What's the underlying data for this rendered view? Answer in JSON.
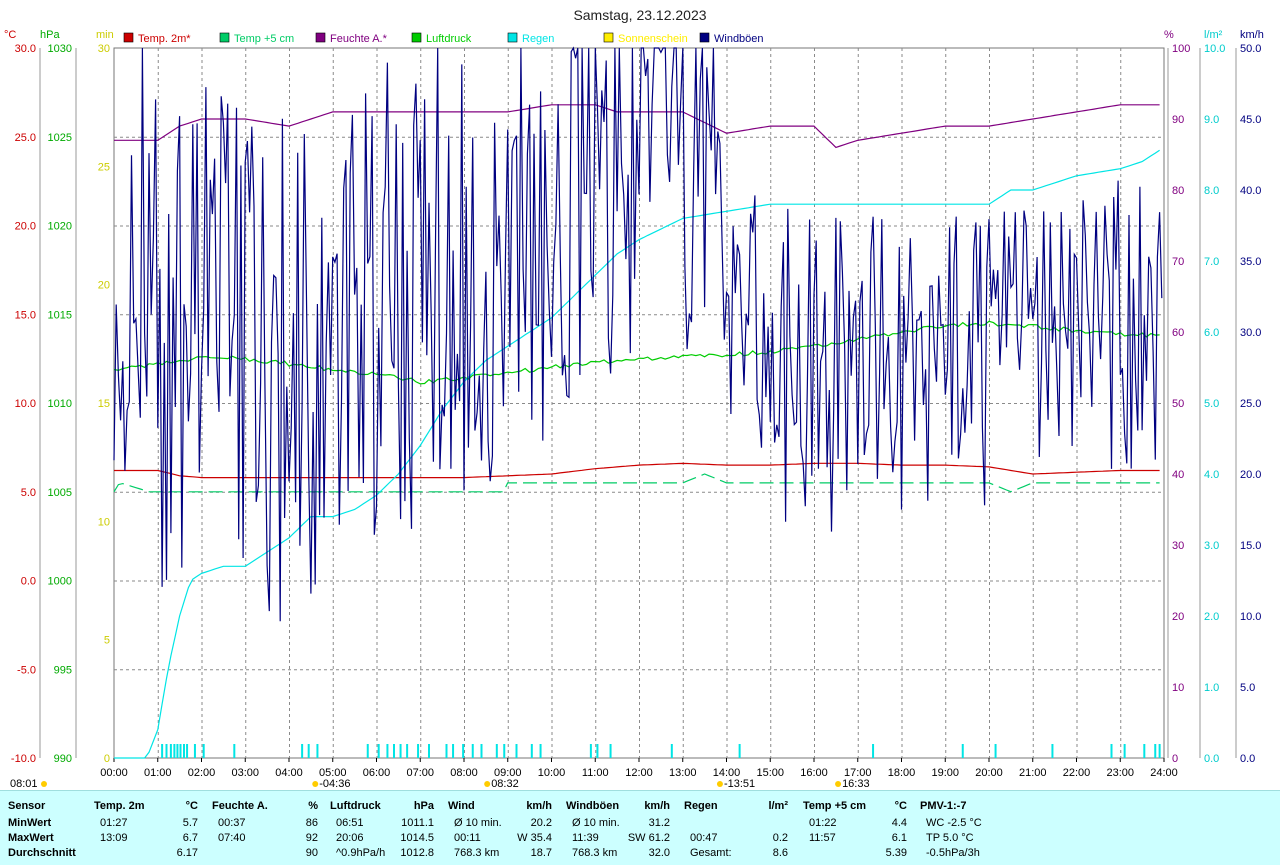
{
  "chart_data": {
    "type": "line",
    "title": "Samstag, 23.12.2023",
    "x": {
      "ticks": [
        "00:00",
        "01:00",
        "02:00",
        "03:00",
        "04:00",
        "05:00",
        "06:00",
        "07:00",
        "08:00",
        "09:00",
        "10:00",
        "11:00",
        "12:00",
        "13:00",
        "14:00",
        "15:00",
        "16:00",
        "17:00",
        "18:00",
        "19:00",
        "20:00",
        "21:00",
        "22:00",
        "23:00",
        "24:00"
      ],
      "range_hours": [
        0,
        24
      ]
    },
    "left_axes": [
      {
        "unit": "°C",
        "color": "#cc0000",
        "range": [
          -10,
          30
        ],
        "ticks": [
          "30.0",
          "25.0",
          "20.0",
          "15.0",
          "10.0",
          "5.0",
          "0.0",
          "-5.0",
          "-10.0"
        ]
      },
      {
        "unit": "hPa",
        "color": "#00aa00",
        "range": [
          990,
          1030
        ],
        "ticks": [
          "1030",
          "1025",
          "1020",
          "1015",
          "1010",
          "1005",
          "1000",
          "995",
          "990"
        ]
      },
      {
        "unit": "min",
        "color": "#cccc00",
        "range": [
          0,
          30
        ],
        "ticks": [
          "30",
          "25",
          "20",
          "15",
          "10",
          "5",
          "0"
        ]
      }
    ],
    "right_axes": [
      {
        "unit": "%",
        "color": "#800080",
        "range": [
          0,
          100
        ],
        "ticks": [
          "100",
          "90",
          "80",
          "70",
          "60",
          "50",
          "40",
          "30",
          "20",
          "10",
          "0"
        ]
      },
      {
        "unit": "l/m²",
        "color": "#00cccc",
        "range": [
          0,
          10
        ],
        "ticks": [
          "10.0",
          "9.0",
          "8.0",
          "7.0",
          "6.0",
          "5.0",
          "4.0",
          "3.0",
          "2.0",
          "1.0",
          "0.0"
        ]
      },
      {
        "unit": "km/h",
        "color": "#000080",
        "range": [
          0,
          50
        ],
        "ticks": [
          "50.0",
          "45.0",
          "40.0",
          "35.0",
          "30.0",
          "25.0",
          "20.0",
          "15.0",
          "10.0",
          "5.0",
          "0.0"
        ]
      }
    ],
    "legend_position": "top",
    "grid": true,
    "legend": [
      {
        "label": "Temp. 2m*",
        "color": "#cc0000"
      },
      {
        "label": "Temp +5 cm",
        "color": "#00cc66"
      },
      {
        "label": "Feuchte A.*",
        "color": "#800080"
      },
      {
        "label": "Luftdruck",
        "color": "#00cc00"
      },
      {
        "label": "Regen",
        "color": "#00e5e5"
      },
      {
        "label": "Sonnenschein",
        "color": "#ffee00"
      },
      {
        "label": "Windböen",
        "color": "#000080"
      }
    ],
    "series": [
      {
        "name": "Temp. 2m*",
        "axis": "°C",
        "color": "#cc0000",
        "x": [
          0,
          0.5,
          1,
          1.5,
          2,
          3,
          4,
          5,
          6,
          7,
          8,
          9,
          10,
          11,
          12,
          13,
          14,
          15,
          16,
          17,
          18,
          19,
          20,
          20.5,
          21,
          22,
          23,
          24
        ],
        "y": [
          6.2,
          6.2,
          6.2,
          5.9,
          5.8,
          5.8,
          5.8,
          5.8,
          5.8,
          5.8,
          5.8,
          5.9,
          6.0,
          6.3,
          6.5,
          6.6,
          6.5,
          6.5,
          6.6,
          6.6,
          6.5,
          6.5,
          6.4,
          6.2,
          6.0,
          6.1,
          6.2,
          6.2
        ]
      },
      {
        "name": "Temp +5 cm",
        "axis": "°C",
        "color": "#00cc66",
        "x": [
          0,
          0.1,
          0.15,
          0.8,
          1.5,
          2,
          3,
          4,
          5,
          6,
          7,
          8,
          8.9,
          9,
          10,
          11,
          12,
          13,
          13.5,
          14,
          15,
          16,
          17,
          18,
          19,
          20,
          20.5,
          21,
          22,
          23,
          24
        ],
        "y": [
          5.0,
          5.4,
          5.5,
          5.0,
          5.0,
          5.0,
          5.0,
          5.0,
          5.0,
          5.0,
          5.0,
          5.0,
          5.0,
          5.5,
          5.5,
          5.5,
          5.5,
          5.5,
          6.0,
          5.5,
          5.5,
          5.5,
          5.5,
          5.5,
          5.5,
          5.5,
          5.0,
          5.5,
          5.5,
          5.5,
          5.5
        ]
      },
      {
        "name": "Feuchte A.*",
        "axis": "%",
        "color": "#800080",
        "x": [
          0,
          0.5,
          1,
          1.5,
          2,
          3,
          4,
          4.5,
          5,
          6,
          7,
          8,
          9,
          10,
          11,
          11.5,
          12,
          13,
          14,
          15,
          16,
          16.5,
          17,
          18,
          19,
          20,
          21,
          22,
          23,
          24
        ],
        "y": [
          87,
          87,
          87,
          89,
          90,
          90,
          89,
          90,
          91,
          91,
          91,
          91,
          91,
          92,
          92,
          91,
          91,
          91,
          88,
          89,
          89,
          86,
          87,
          88,
          89,
          89,
          90,
          91,
          92,
          92
        ]
      },
      {
        "name": "Luftdruck",
        "axis": "hPa",
        "color": "#00cc00",
        "x": [
          0,
          1,
          2,
          3,
          4,
          5,
          6,
          7,
          8,
          9,
          10,
          11,
          12,
          13,
          14,
          15,
          16,
          17,
          18,
          19,
          20,
          21,
          22,
          23,
          24
        ],
        "y": [
          1011.8,
          1012.2,
          1012.6,
          1012.5,
          1012.2,
          1011.9,
          1011.6,
          1011.2,
          1011.4,
          1011.7,
          1012.0,
          1012.3,
          1012.5,
          1012.6,
          1012.7,
          1012.9,
          1013.2,
          1013.6,
          1014.0,
          1014.4,
          1014.5,
          1014.3,
          1014.1,
          1013.9,
          1013.8
        ]
      },
      {
        "name": "Regen",
        "axis": "l/m²",
        "color": "#00e5e5",
        "x": [
          0,
          0.75,
          1,
          1.25,
          1.5,
          1.75,
          2,
          2.5,
          3,
          3.5,
          4,
          4.5,
          5,
          5.5,
          6,
          6.5,
          7,
          7.5,
          8,
          8.5,
          9,
          9.5,
          10,
          10.5,
          11,
          11.5,
          12,
          13,
          14,
          15,
          16,
          17,
          18,
          19,
          20,
          20.5,
          21,
          22,
          23,
          23.5,
          24
        ],
        "y": [
          0,
          0,
          0.4,
          1.3,
          2.0,
          2.5,
          2.6,
          2.7,
          2.7,
          2.9,
          3.1,
          3.4,
          3.4,
          3.5,
          3.7,
          4.0,
          4.4,
          4.9,
          5.3,
          5.6,
          5.8,
          6.0,
          6.2,
          6.5,
          6.8,
          7.1,
          7.3,
          7.6,
          7.7,
          7.8,
          7.8,
          7.8,
          7.8,
          7.8,
          7.8,
          8.0,
          8.0,
          8.2,
          8.3,
          8.4,
          8.6
        ]
      },
      {
        "name": "Windböen",
        "axis": "km/h",
        "color": "#000080",
        "kind": "gust",
        "x": [
          0,
          0.5,
          1,
          1.5,
          2,
          2.5,
          3,
          3.5,
          4,
          4.5,
          5,
          5.5,
          6,
          6.5,
          7,
          7.5,
          8,
          8.5,
          9,
          9.5,
          10,
          10.5,
          11,
          11.5,
          12,
          12.5,
          13,
          13.5,
          14,
          14.5,
          15,
          15.5,
          16,
          16.5,
          17,
          17.5,
          18,
          18.5,
          19,
          19.5,
          20,
          20.5,
          21,
          21.5,
          22,
          22.5,
          23,
          23.5,
          24
        ],
        "y": [
          33,
          35,
          30,
          30,
          31,
          30,
          29,
          28,
          27,
          29,
          31,
          33,
          32,
          33,
          33,
          34,
          35,
          34,
          36,
          37,
          36,
          39,
          42,
          44,
          46,
          47,
          46,
          42,
          35,
          31,
          29,
          27,
          26,
          27,
          28,
          29,
          27,
          27,
          29,
          28,
          27,
          29,
          30,
          31,
          31,
          29,
          30,
          33,
          31
        ],
        "amplitude": [
          12,
          13,
          14,
          13,
          12,
          12,
          12,
          13,
          13,
          13,
          12,
          12,
          12,
          12,
          13,
          12,
          12,
          12,
          11,
          11,
          11,
          11,
          12,
          12,
          12,
          12,
          12,
          12,
          8,
          8,
          8,
          9,
          9,
          8,
          8,
          8,
          7,
          7,
          7,
          7,
          8,
          8,
          7,
          7,
          8,
          8,
          8,
          8,
          8
        ]
      }
    ],
    "rain_events_hours": [
      1.1,
      1.2,
      1.3,
      1.38,
      1.45,
      1.52,
      1.6,
      1.67,
      1.85,
      2.05,
      2.75,
      4.3,
      4.45,
      4.65,
      5.8,
      6.05,
      6.25,
      6.4,
      6.55,
      6.7,
      6.95,
      7.2,
      7.6,
      7.75,
      7.98,
      8.2,
      8.4,
      8.75,
      8.92,
      9.2,
      9.55,
      9.75,
      10.9,
      11.05,
      11.35,
      12.75,
      14.3,
      17.35,
      19.4,
      20.15,
      21.45,
      22.8,
      23.1,
      23.55,
      23.8,
      23.9
    ],
    "sun_marks": [
      {
        "time": "08:01",
        "hour": 8.02
      },
      {
        "time": "-04:36",
        "hour": 4.6
      },
      {
        "time": "08:32",
        "hour": 8.53
      },
      {
        "time": "-13:51",
        "hour": 13.85
      },
      {
        "time": "16:33",
        "hour": 16.55
      }
    ],
    "table": {
      "columns": [
        {
          "name": "Sensor",
          "unit": ""
        },
        {
          "name": "Temp. 2m",
          "unit": "°C"
        },
        {
          "name": "Feuchte A.",
          "unit": "%"
        },
        {
          "name": "Luftdruck",
          "unit": "hPa"
        },
        {
          "name": "Wind",
          "unit": "km/h"
        },
        {
          "name": "Windböen",
          "unit": "km/h"
        },
        {
          "name": "Regen",
          "unit": "l/m²"
        },
        {
          "name": "Temp +5 cm",
          "unit": "°C"
        },
        {
          "name": "PMV-1:-7",
          "unit": ""
        }
      ],
      "rows": [
        {
          "label": "MinWert",
          "cells": [
            [
              "01:27",
              "5.7"
            ],
            [
              "00:37",
              "86"
            ],
            [
              "06:51",
              "1011.1"
            ],
            [
              "Ø 10 min.",
              "20.2"
            ],
            [
              "Ø 10 min.",
              "31.2"
            ],
            [
              "",
              ""
            ],
            [
              "01:22",
              "4.4"
            ],
            [
              "WC -2.5 °C",
              ""
            ]
          ]
        },
        {
          "label": "MaxWert",
          "cells": [
            [
              "13:09",
              "6.7"
            ],
            [
              "07:40",
              "92"
            ],
            [
              "20:06",
              "1014.5"
            ],
            [
              "00:11",
              "W 35.4"
            ],
            [
              "11:39",
              "SW 61.2"
            ],
            [
              "00:47",
              "0.2"
            ],
            [
              "11:57",
              "6.1"
            ],
            [
              "TP 5.0 °C",
              ""
            ]
          ]
        },
        {
          "label": "Durchschnitt",
          "cells": [
            [
              "",
              "6.17"
            ],
            [
              "",
              "90"
            ],
            [
              "^0.9hPa/h",
              "1012.8"
            ],
            [
              "768.3 km",
              "18.7"
            ],
            [
              "768.3 km",
              "32.0"
            ],
            [
              "Gesamt:",
              "8.6"
            ],
            [
              "",
              "5.39"
            ],
            [
              "-0.5hPa/3h",
              ""
            ]
          ]
        }
      ]
    }
  }
}
